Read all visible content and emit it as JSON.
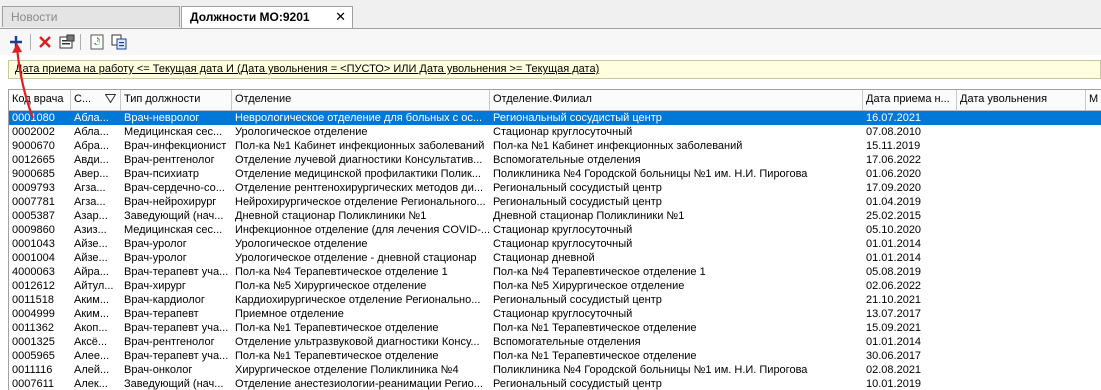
{
  "tabs": [
    {
      "label": "Новости"
    },
    {
      "label": "Должности МО:9201",
      "close": "✕"
    }
  ],
  "filter": {
    "text": "Дата приема на работу <=  Текущая дата И (Дата увольнения = <ПУСТО> ИЛИ Дата увольнения >=  Текущая дата)"
  },
  "grid": {
    "headers": [
      "Код врача",
      "С...",
      "Тип должности",
      "Отделение",
      "Отделение.Филиал",
      "Дата приема н...",
      "Дата увольнения",
      "М"
    ],
    "rows": [
      [
        "0001080",
        "Абла...",
        "Врач-невролог",
        "Неврологическое отделение для больных с ос...",
        "Региональный сосудистый центр",
        "16.07.2021",
        ""
      ],
      [
        "0002002",
        "Абла...",
        "Медицинская сес...",
        "Урологическое отделение",
        "Стационар круглосуточный",
        "07.08.2010",
        ""
      ],
      [
        "9000670",
        "Абра...",
        "Врач-инфекционист",
        "Пол-ка №1 Кабинет инфекционных заболеваний",
        "Пол-ка №1 Кабинет инфекционных заболеваний",
        "15.11.2019",
        ""
      ],
      [
        "0012665",
        "Авди...",
        "Врач-рентгенолог",
        "Отделение лучевой диагностики Консультатив...",
        "Вспомогательные отделения",
        "17.06.2022",
        ""
      ],
      [
        "9000685",
        "Авер...",
        "Врач-психиатр",
        "Отделение медицинской профилактики Полик...",
        "Поликлиника №4 Городской больницы №1 им. Н.И. Пирогова",
        "01.06.2020",
        ""
      ],
      [
        "0009793",
        "Агза...",
        "Врач-сердечно-со...",
        "Отделение рентгенохирургических методов ди...",
        "Региональный сосудистый центр",
        "17.09.2020",
        ""
      ],
      [
        "0007781",
        "Агза...",
        "Врач-нейрохирург",
        "Нейрохирургическое отделение Регионального...",
        "Региональный сосудистый центр",
        "01.04.2019",
        ""
      ],
      [
        "0005387",
        "Азар...",
        "Заведующий (нач...",
        "Дневной стационар Поликлиники №1",
        "Дневной стационар Поликлиники №1",
        "25.02.2015",
        ""
      ],
      [
        "0009860",
        "Азиз...",
        "Медицинская сес...",
        "Инфекционное отделение (для лечения COVID-...",
        "Стационар круглосуточный",
        "05.10.2020",
        ""
      ],
      [
        "0001043",
        "Айзе...",
        "Врач-уролог",
        "Урологическое отделение",
        "Стационар круглосуточный",
        "01.01.2014",
        ""
      ],
      [
        "0001004",
        "Айзе...",
        "Врач-уролог",
        "Урологическое отделение - дневной стационар",
        "Стационар дневной",
        "01.01.2014",
        ""
      ],
      [
        "4000063",
        "Айра...",
        "Врач-терапевт уча...",
        "Пол-ка №4 Терапевтическое отделение 1",
        "Пол-ка №4 Терапевтическое отделение 1",
        "05.08.2019",
        ""
      ],
      [
        "0012612",
        "Айтул...",
        "Врач-хирург",
        "Пол-ка №5 Хирургическое отделение",
        "Пол-ка №5 Хирургическое отделение",
        "02.06.2022",
        ""
      ],
      [
        "0011518",
        "Аким...",
        "Врач-кардиолог",
        "Кардиохирургическое отделение Регионально...",
        "Региональный сосудистый центр",
        "21.10.2021",
        ""
      ],
      [
        "0004999",
        "Аким...",
        "Врач-терапевт",
        "Приемное отделение",
        "Стационар круглосуточный",
        "13.07.2017",
        ""
      ],
      [
        "0011362",
        "Акоп...",
        "Врач-терапевт уча...",
        "Пол-ка №1 Терапевтическое отделение",
        "Пол-ка №1 Терапевтическое отделение",
        "15.09.2021",
        ""
      ],
      [
        "0001325",
        "Аксё...",
        "Врач-рентгенолог",
        "Отделение ультразвуковой диагностики Консу...",
        "Вспомогательные отделения",
        "01.01.2014",
        ""
      ],
      [
        "0005965",
        "Алее...",
        "Врач-терапевт уча...",
        "Пол-ка №1 Терапевтическое отделение",
        "Пол-ка №1 Терапевтическое отделение",
        "30.06.2017",
        ""
      ],
      [
        "0011116",
        "Алей...",
        "Врач-онколог",
        "Хирургическое отделение Поликлиника №4",
        "Поликлиника №4 Городской больницы №1 им. Н.И. Пирогова",
        "02.08.2021",
        ""
      ],
      [
        "0007611",
        "Алек...",
        "Заведующий (нач...",
        "Отделение анестезиологии-реанимации Регио...",
        "Региональный сосудистый центр",
        "10.01.2019",
        ""
      ]
    ]
  },
  "toolbar_icons": [
    "plus-icon",
    "delete-icon",
    "properties-icon",
    "refresh-icon",
    "copy-icon"
  ],
  "colors": {
    "selection": "#0078d7",
    "filter_bg": "#ffffe0",
    "annotation_arrow": "#e02020"
  }
}
